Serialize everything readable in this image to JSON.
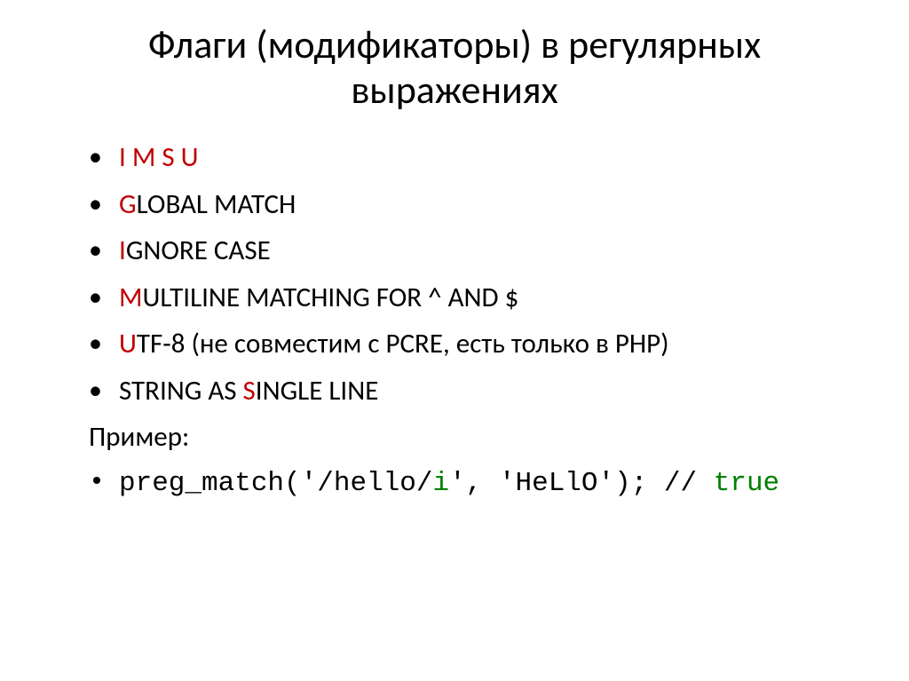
{
  "title": "Флаги (модификаторы) в регулярных выражениях",
  "li1": {
    "a": "I",
    "b": " ",
    "c": "M",
    "d": " ",
    "e": "S",
    "f": " ",
    "g": "U"
  },
  "li2": {
    "a": "G",
    "b": "LOBAL MATCH"
  },
  "li3": {
    "a": "I",
    "b": "GNORE CASE"
  },
  "li4": {
    "a": "M",
    "b": "ULTILINE MATCHING FOR ^ AND $"
  },
  "li5": {
    "a": "U",
    "b": "TF-8 (не совместим с PCRE, есть только в PHP)"
  },
  "li6": {
    "a": "STRING AS ",
    "b": "S",
    "c": "INGLE LINE"
  },
  "example_label": "Пример:",
  "code": {
    "a": "preg_match('/hello/",
    "b": "i",
    "c": "', 'HeLlO');  // ",
    "d": "true"
  }
}
